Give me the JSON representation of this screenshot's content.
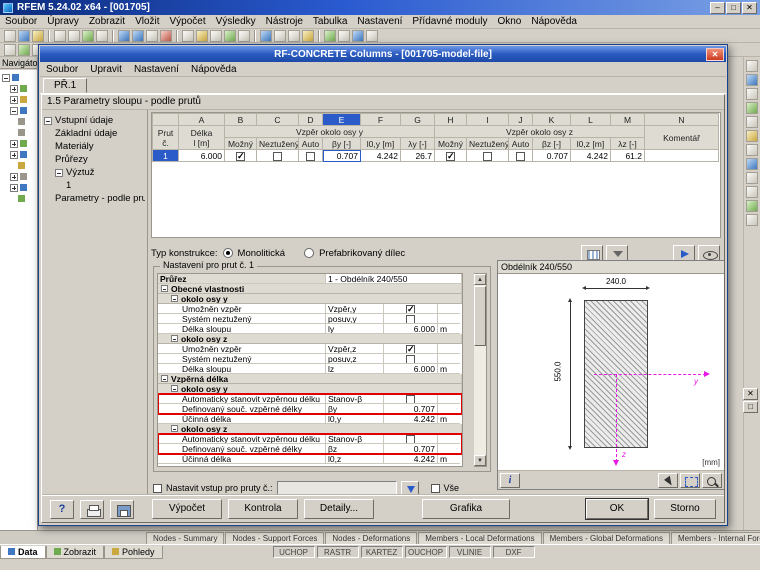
{
  "app": {
    "title": "RFEM 5.24.02 x64 - [001705]",
    "menus": [
      "Soubor",
      "Úpravy",
      "Zobrazit",
      "Vložit",
      "Výpočet",
      "Výsledky",
      "Nástroje",
      "Tabulka",
      "Nastavení",
      "Přídavné moduly",
      "Okno",
      "Nápověda"
    ],
    "navigator_title": "Navigátor",
    "bottom_tabs": [
      "Data",
      "Zobrazit",
      "Pohledy"
    ],
    "status_items": [
      "UCHOP",
      "RASTR",
      "KARTEZ",
      "OUCHOP",
      "VLINIE",
      "DXF"
    ],
    "table_tabs": [
      "Nodes - Summary",
      "Nodes - Support Forces",
      "Nodes - Deformations",
      "Members - Local Deformations",
      "Members - Global Deformations",
      "Members - Internal Forces"
    ]
  },
  "dialog": {
    "title": "RF-CONCRETE Columns - [001705-model-file]",
    "menus": [
      "Soubor",
      "Upravit",
      "Nastavení",
      "Nápověda"
    ],
    "tab": "PŘ.1",
    "section_title": "1.5 Parametry sloupu - podle  prutů",
    "nav": {
      "root": "Vstupní údaje",
      "item0": "Základní údaje",
      "item1": "Materiály",
      "item2": "Průřezy",
      "item3": "Výztuž",
      "item4": "1",
      "item5": "Parametry - podle prutů"
    },
    "table": {
      "letters": [
        "A",
        "B",
        "C",
        "D",
        "E",
        "F",
        "G",
        "H",
        "I",
        "J",
        "K",
        "L",
        "M",
        "N"
      ],
      "h_member": "Prut\nč.",
      "h_length": "Délka\nl [m]",
      "h_group_y": "Vzpěr okolo osy y",
      "h_group_z": "Vzpěr okolo osy z",
      "h_comment": "Komentář",
      "sub": [
        "Možný",
        "Neztužený",
        "Auto",
        "βy [-]",
        "l0,y [m]",
        "λy [-]",
        "Možný",
        "Neztužený",
        "Auto",
        "βz [-]",
        "l0,z [m]",
        "λz [-]"
      ],
      "row1": {
        "no": "1",
        "length": "6.000",
        "m_y": true,
        "nz_y": false,
        "auto_y": false,
        "beta_y": "0.707",
        "l0y": "4.242",
        "lambda_y": "26.7",
        "m_z": true,
        "nz_z": false,
        "auto_z": false,
        "beta_z": "0.707",
        "l0z": "4.242",
        "lambda_z": "61.2",
        "comment": ""
      }
    },
    "construction": {
      "label": "Typ konstrukce:",
      "opt1": "Monolitická",
      "opt1_selected": true,
      "opt2": "Prefabrikovaný dílec",
      "opt2_selected": false
    },
    "settings": {
      "title": "Nastavení pro prut č. 1",
      "r0": {
        "label": "Průřez",
        "value": "1 - Obdélník 240/550"
      },
      "g1": "Obecné vlastnosti",
      "g2": "okolo osy y",
      "r3": {
        "label": "Umožněn vzpěr",
        "sym": "Vzpěr,y",
        "checked": true
      },
      "r4": {
        "label": "Systém neztužený",
        "sym": "posuv,y",
        "checked": false
      },
      "r5": {
        "label": "Délka sloupu",
        "sym": "ly",
        "val": "6.000",
        "unit": "m"
      },
      "g6": "okolo osy z",
      "r7": {
        "label": "Umožněn vzpěr",
        "sym": "Vzpěr,z",
        "checked": true
      },
      "r8": {
        "label": "Systém neztužený",
        "sym": "posuv,z",
        "checked": false
      },
      "r9": {
        "label": "Délka sloupu",
        "sym": "lz",
        "val": "6.000",
        "unit": "m"
      },
      "g10": "Vzpěrná délka",
      "g11": "okolo osy y",
      "r12": {
        "label": "Automaticky stanovit vzpěrnou délku",
        "sym": "Stanov-β",
        "checked": false
      },
      "r13": {
        "label": "Definovaný souč. vzpěrné délky",
        "sym": "βy",
        "val": "0.707"
      },
      "r14": {
        "label": "Účinná délka",
        "sym": "l0,y",
        "val": "4.242",
        "unit": "m"
      },
      "g15": "okolo osy z",
      "r16": {
        "label": "Automaticky stanovit vzpěrnou délku",
        "sym": "Stanov-β",
        "checked": false
      },
      "r17": {
        "label": "Definovaný souč. vzpěrné délky",
        "sym": "βz",
        "val": "0.707"
      },
      "r18": {
        "label": "Účinná délka",
        "sym": "l0,z",
        "val": "4.242",
        "unit": "m"
      }
    },
    "assign": {
      "label": "Nastavit vstup pro pruty č.:",
      "all": "Vše",
      "value": ""
    },
    "section_panel": {
      "title": "Obdélník 240/550",
      "dim_w": "240.0",
      "dim_h": "550.0",
      "unit": "[mm]",
      "axis_y": "y",
      "axis_z": "z"
    },
    "buttons": {
      "calc": "Výpočet",
      "check": "Kontrola",
      "details": "Detaily...",
      "graphics": "Grafika",
      "ok": "OK",
      "cancel": "Storno"
    }
  }
}
